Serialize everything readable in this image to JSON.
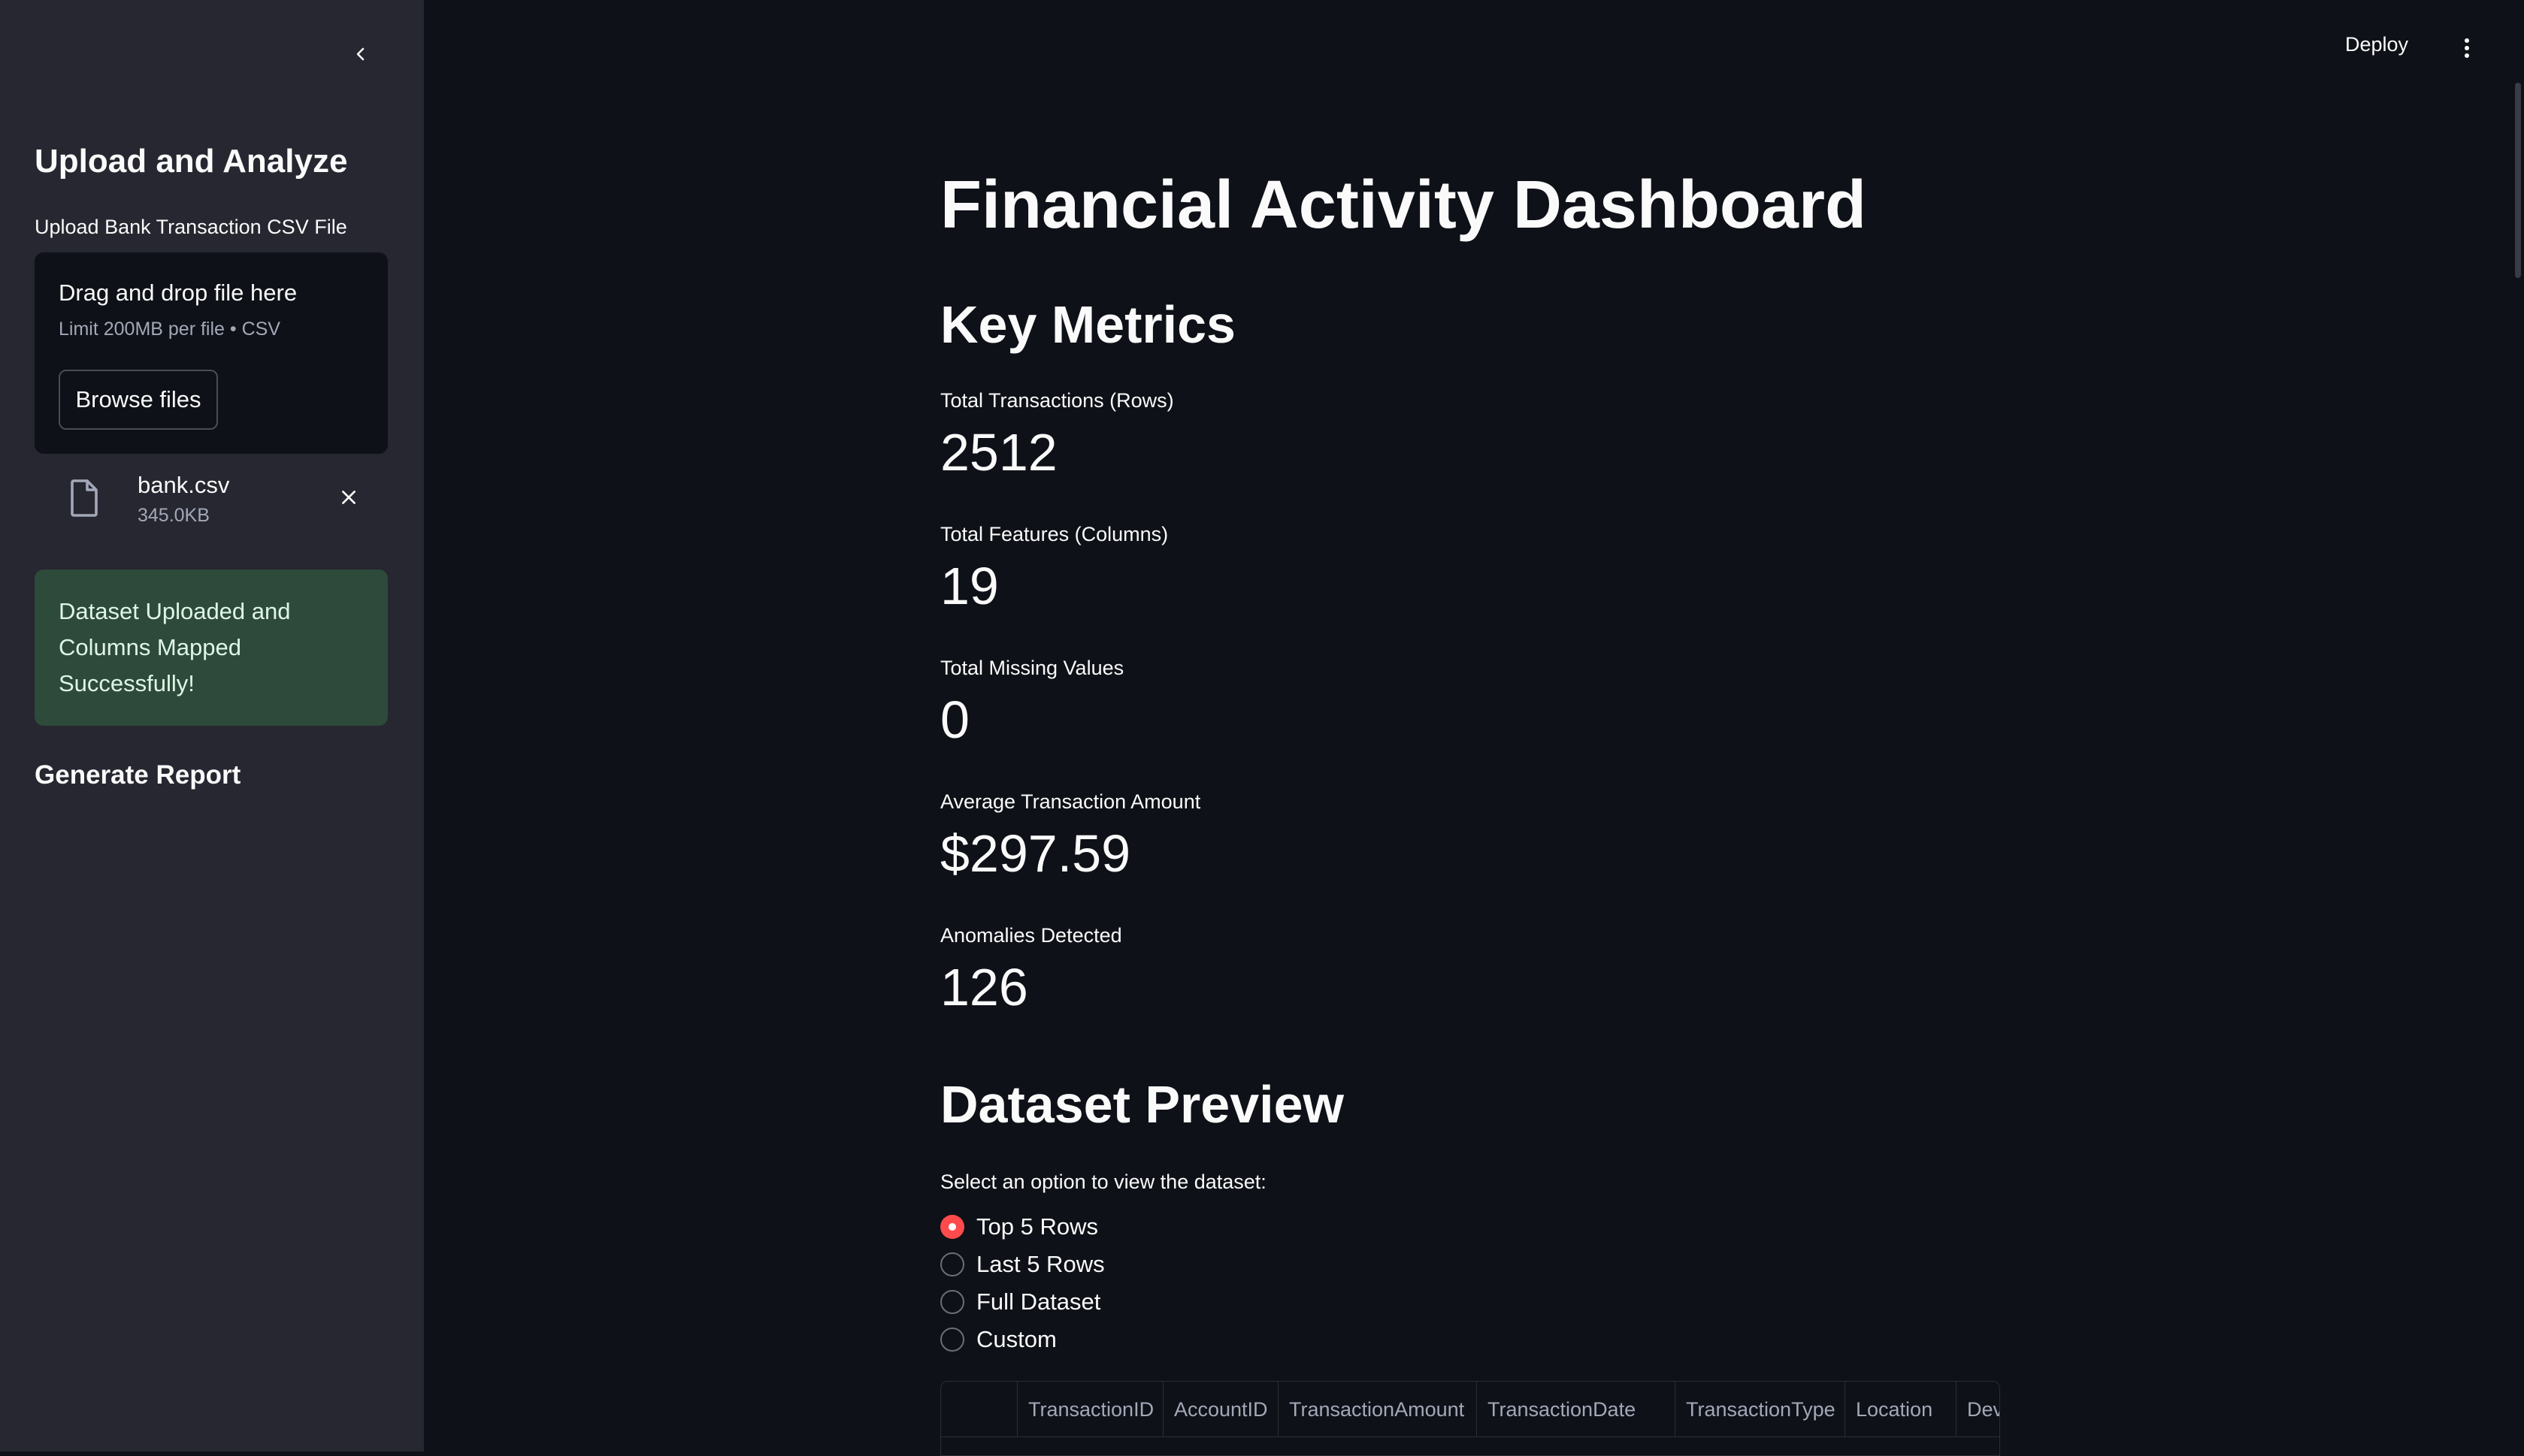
{
  "sidebar": {
    "collapse_icon": "chevron-left-icon",
    "title": "Upload and Analyze",
    "upload_label": "Upload Bank Transaction CSV File",
    "dropzone": {
      "title": "Drag and drop file here",
      "subtitle": "Limit 200MB per file • CSV",
      "browse_label": "Browse files"
    },
    "file": {
      "name": "bank.csv",
      "size": "345.0KB",
      "icon": "file-icon",
      "remove_icon": "close-icon"
    },
    "success_message": "Dataset Uploaded and Columns Mapped Successfully!",
    "generate_label": "Generate Report"
  },
  "header": {
    "deploy_label": "Deploy",
    "menu_icon": "more-vertical-icon"
  },
  "main": {
    "title": "Financial Activity Dashboard",
    "key_metrics_title": "Key Metrics",
    "metrics": [
      {
        "label": "Total Transactions (Rows)",
        "value": "2512"
      },
      {
        "label": "Total Features (Columns)",
        "value": "19"
      },
      {
        "label": "Total Missing Values",
        "value": "0"
      },
      {
        "label": "Average Transaction Amount",
        "value": "$297.59"
      },
      {
        "label": "Anomalies Detected",
        "value": "126"
      }
    ],
    "preview_title": "Dataset Preview",
    "radio_prompt": "Select an option to view the dataset:",
    "radio_options": [
      "Top 5 Rows",
      "Last 5 Rows",
      "Full Dataset",
      "Custom"
    ],
    "radio_selected": "Top 5 Rows",
    "table_columns": [
      "",
      "TransactionID",
      "AccountID",
      "TransactionAmount",
      "TransactionDate",
      "TransactionType",
      "Location",
      "Dev"
    ]
  },
  "colors": {
    "app_background": "#0e1117",
    "sidebar_background": "#262730",
    "accent": "#ff4b4b",
    "success_background": "#2e4a3a"
  }
}
